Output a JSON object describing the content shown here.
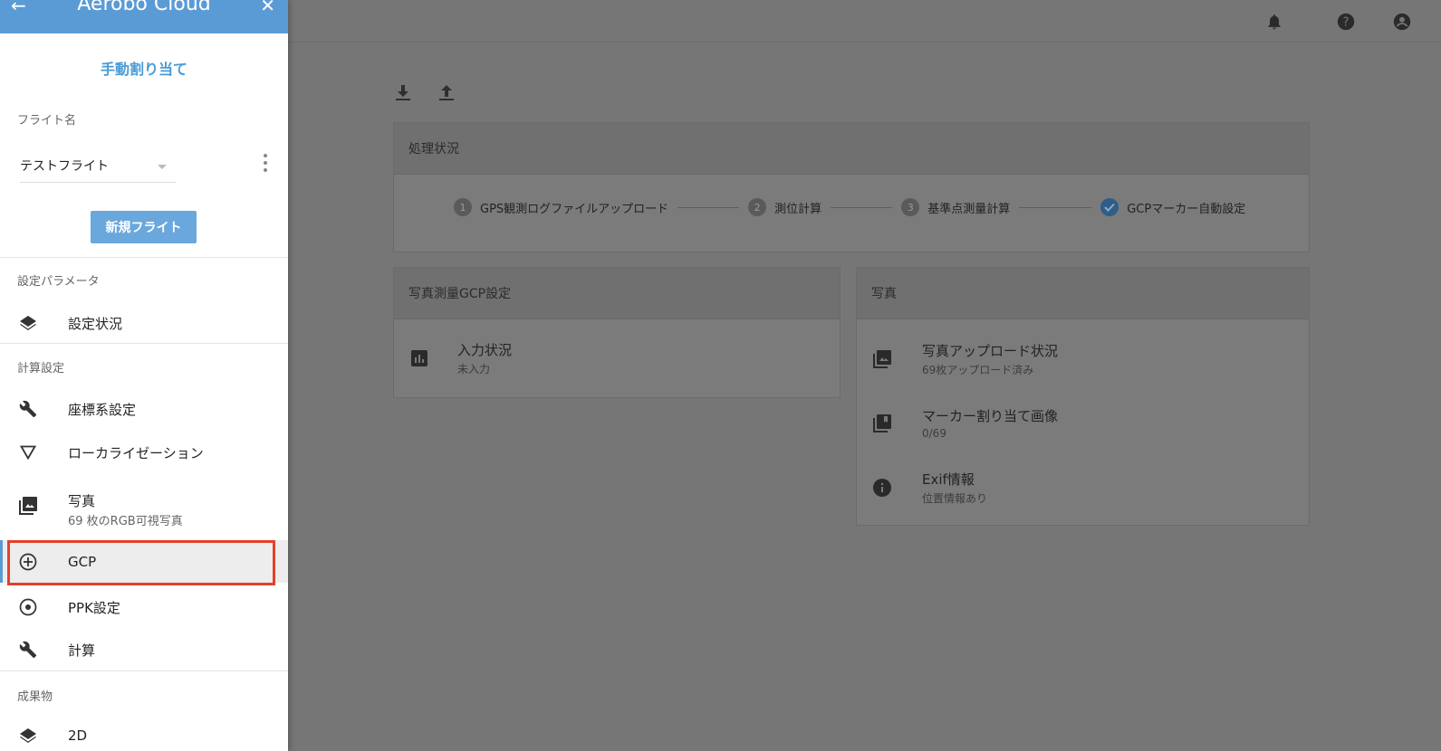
{
  "app": {
    "title": "Aerobo Cloud"
  },
  "sidebar": {
    "subtitle": "手動割り当て",
    "flight_label": "フライト名",
    "flight_value": "テストフライト",
    "new_flight_button": "新規フライト",
    "sections": {
      "settings_params": "設定パラメータ",
      "calc_settings": "計算設定",
      "deliverables": "成果物"
    },
    "items": {
      "settings_status": "設定状況",
      "coordinate_system": "座標系設定",
      "localization": "ローカライゼーション",
      "photos": "写真",
      "photos_sub": "69 枚のRGB可視写真",
      "gcp": "GCP",
      "ppk": "PPK設定",
      "calculation": "計算",
      "two_d": "2D"
    }
  },
  "main": {
    "processing": {
      "title": "処理状況",
      "steps": [
        {
          "num": "1",
          "label": "GPS観測ログファイルアップロード"
        },
        {
          "num": "2",
          "label": "測位計算"
        },
        {
          "num": "3",
          "label": "基準点測量計算"
        },
        {
          "num": "",
          "label": "GCPマーカー自動設定"
        }
      ]
    },
    "gcp_card": {
      "title": "写真測量GCP設定",
      "input_status": "入力状況",
      "input_status_value": "未入力"
    },
    "photo_card": {
      "title": "写真",
      "upload_status": "写真アップロード状況",
      "upload_status_value": "69枚アップロード済み",
      "marker_images": "マーカー割り当て画像",
      "marker_images_value": "0/69",
      "exif": "Exif情報",
      "exif_value": "位置情報あり"
    }
  },
  "colors": {
    "accent": "#5b9bd5",
    "highlight": "#e5402a",
    "step_done": "#2f5d88"
  }
}
